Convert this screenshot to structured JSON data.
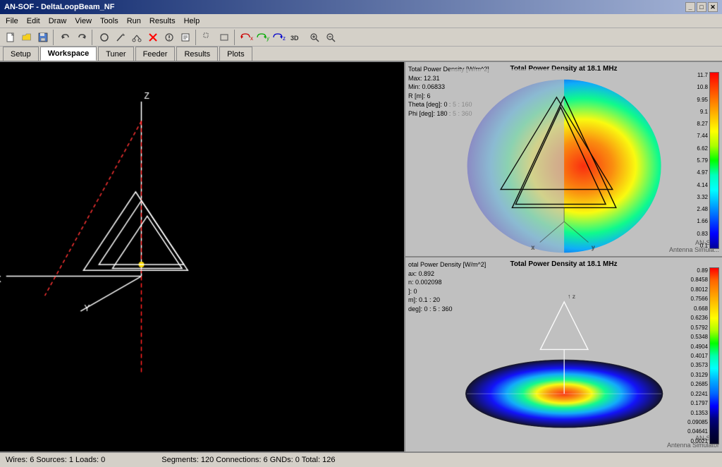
{
  "window": {
    "title": "AN-SOF - DeltaLoopBeam_NF"
  },
  "titlebar": {
    "title": "AN-SOF - DeltaLoopBeam_NF",
    "controls": [
      "_",
      "□",
      "✕"
    ]
  },
  "menubar": {
    "items": [
      "File",
      "Edit",
      "Draw",
      "View",
      "Tools",
      "Run",
      "Results",
      "Help"
    ]
  },
  "toolbar": {
    "buttons": [
      "📄",
      "📂",
      "💾",
      "↩",
      "↪",
      "○",
      "✏",
      "✂",
      "❌",
      "⊕",
      "📌",
      "🔄",
      "x",
      "y",
      "z",
      "3D",
      "🔍+",
      "🔍-"
    ]
  },
  "tabs": {
    "items": [
      "Setup",
      "Workspace",
      "Tuner",
      "Feeder",
      "Results",
      "Plots"
    ],
    "active": "Workspace"
  },
  "workspace3d": {
    "axes": {
      "x": "X",
      "y": "Y",
      "z": "Z"
    }
  },
  "plots": {
    "top": {
      "title": "Total Power Density at 18.1 MHz",
      "info_title": "Total Power Density [W/m^2]",
      "max": "Max: 12.31",
      "min": "Min: 0.06833",
      "r": "R [m]: 6",
      "theta": "Theta [deg]: 0 : 5 : 160",
      "phi": "Phi [deg]: 180 : 5 : 360",
      "watermark_line1": "AN-SOF",
      "watermark_line2": "Antenna Simula...",
      "colorscale": [
        "11.7",
        "10.8",
        "9.95",
        "9.1",
        "8.27",
        "7.44",
        "6.62",
        "5.79",
        "4.97",
        "4.14",
        "3.32",
        "2.48",
        "1.66",
        "0.83",
        "0.1"
      ]
    },
    "bottom": {
      "title": "Total Power Density at 18.1 MHz",
      "info_title": "otal Power Density [W/m^2]",
      "max": "ax: 0.892",
      "min": "n: 0.002098",
      "r": "]: 0",
      "r2": "m]: 0.1 : 20",
      "phi": "deg]: 0 : 5 : 360",
      "watermark_line1": "AN-SOF",
      "watermark_line2": "Antenna Simulator",
      "colorscale": [
        "0.89",
        "0.8458",
        "0.8012",
        "0.7566",
        "0.668",
        "0.6236",
        "0.5792",
        "0.5348",
        "0.4904",
        "0.4017",
        "0.3573",
        "0.3129",
        "0.2685",
        "0.2241",
        "0.1797",
        "0.1353",
        "0.09085",
        "0.04641",
        "0.0021"
      ]
    }
  },
  "statusbar": {
    "text": "Wires: 6  Sources: 1  Loads: 0",
    "text2": "Segments: 120  Connections: 6  GNDs: 0  Total: 126"
  }
}
